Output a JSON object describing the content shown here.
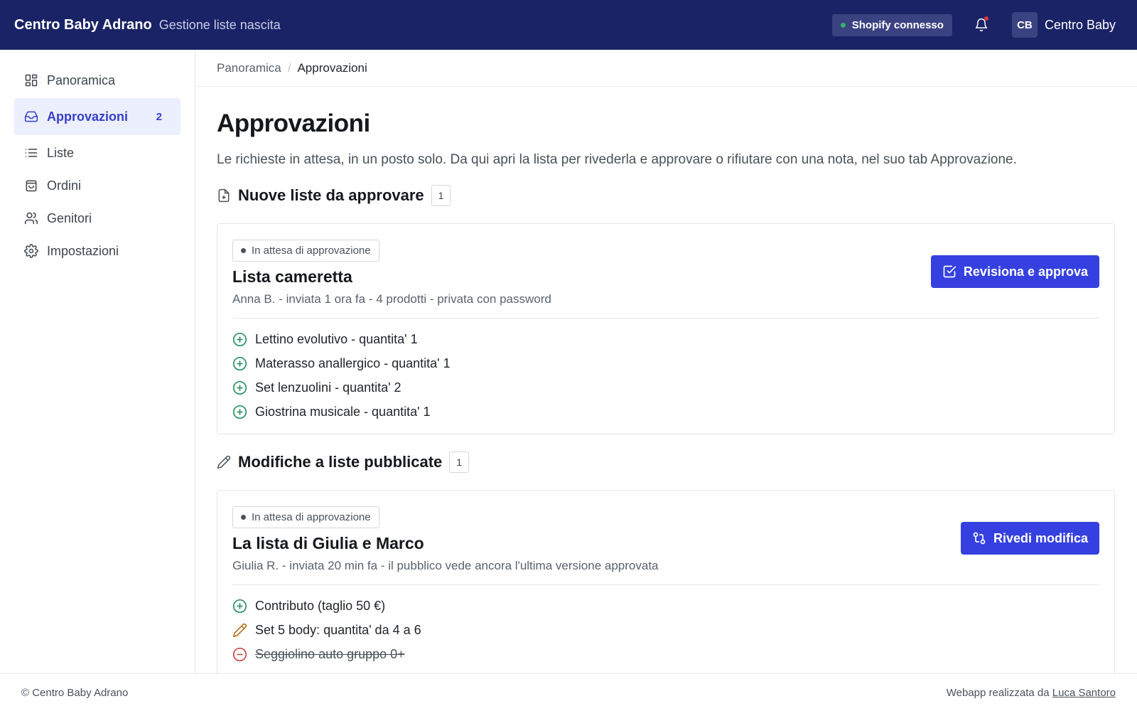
{
  "header": {
    "brand": "Centro Baby Adrano",
    "subtitle": "Gestione liste nascita",
    "shopify_status": "Shopify connesso",
    "user_initials": "CB",
    "user_name": "Centro Baby",
    "colors": {
      "bar": "#1a2366",
      "accent": "#3640e0",
      "connected": "#2fb36e",
      "notification": "#e03434"
    }
  },
  "sidebar": {
    "items": [
      {
        "label": "Panoramica",
        "icon": "grid-icon"
      },
      {
        "label": "Approvazioni",
        "icon": "inbox-icon",
        "count": "2",
        "active": true
      },
      {
        "label": "Liste",
        "icon": "list-icon"
      },
      {
        "label": "Ordini",
        "icon": "shopping-bag-icon"
      },
      {
        "label": "Genitori",
        "icon": "users-icon"
      },
      {
        "label": "Impostazioni",
        "icon": "gear-icon"
      }
    ]
  },
  "breadcrumb": {
    "parent": "Panoramica",
    "separator": "/",
    "current": "Approvazioni"
  },
  "page": {
    "title": "Approvazioni",
    "description": "Le richieste in attesa, in un posto solo. Da qui apri la lista per rivederla e approvare o rifiutare con una nota, nel suo tab Approvazione."
  },
  "sections": [
    {
      "title": "Nuove liste da approvare",
      "count": "1",
      "icon": "file-plus-icon",
      "card": {
        "status": "In attesa di approvazione",
        "title": "Lista cameretta",
        "meta": "Anna B. - inviata 1 ora fa - 4 prodotti - privata con password",
        "action": "Revisiona e approva",
        "action_icon": "check-square-icon",
        "items": [
          {
            "text": "Lettino evolutivo - quantita' 1",
            "type": "added"
          },
          {
            "text": "Materasso anallergico - quantita' 1",
            "type": "added"
          },
          {
            "text": "Set lenzuolini - quantita' 2",
            "type": "added"
          },
          {
            "text": "Giostrina musicale - quantita' 1",
            "type": "added"
          }
        ]
      }
    },
    {
      "title": "Modifiche a liste pubblicate",
      "count": "1",
      "icon": "pencil-icon",
      "card": {
        "status": "In attesa di approvazione",
        "title": "La lista di Giulia e Marco",
        "meta": "Giulia R. - inviata 20 min fa - il pubblico vede ancora l'ultima versione approvata",
        "action": "Rivedi modifica",
        "action_icon": "git-compare-icon",
        "items": [
          {
            "text": "Contributo (taglio 50 €)",
            "type": "added"
          },
          {
            "text": "Set 5 body: quantita' da 4 a 6",
            "type": "modified"
          },
          {
            "text": "Seggiolino auto gruppo 0+",
            "type": "removed"
          }
        ]
      }
    }
  ],
  "footer": {
    "copyright": "© Centro Baby Adrano",
    "credit_prefix": "Webapp realizzata da",
    "credit_link": "Luca Santoro"
  }
}
